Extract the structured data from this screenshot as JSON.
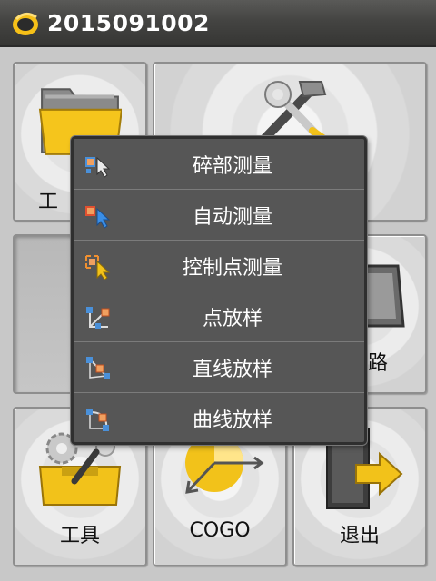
{
  "titlebar": {
    "title": "2015091002",
    "logo_icon": "helmet-logo-icon"
  },
  "tiles": {
    "project_label": "工",
    "settings_label": "",
    "road_label": "路",
    "tools_label": "工具",
    "cogo_label": "COGO",
    "exit_label": "退出"
  },
  "menu": {
    "items": [
      {
        "label": "碎部测量",
        "icon": "cursor-point-icon"
      },
      {
        "label": "自动测量",
        "icon": "cursor-auto-icon"
      },
      {
        "label": "控制点测量",
        "icon": "cursor-control-icon"
      },
      {
        "label": "点放样",
        "icon": "point-stakeout-icon"
      },
      {
        "label": "直线放样",
        "icon": "line-stakeout-icon"
      },
      {
        "label": "曲线放样",
        "icon": "curve-stakeout-icon"
      }
    ]
  },
  "colors": {
    "titlebar": "#444442",
    "menu_bg": "#565656",
    "menu_text": "#ffffff",
    "accent_yellow": "#f2c21a"
  }
}
